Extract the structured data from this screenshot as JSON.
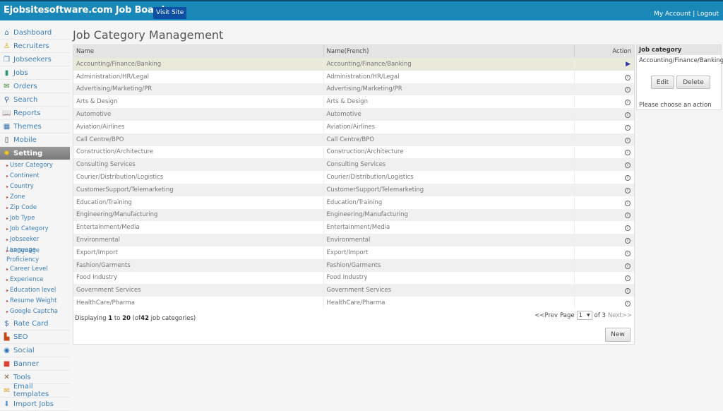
{
  "header": {
    "brand": "Ejobsitesoftware.com Job Board",
    "visit_site": "Visit Site",
    "my_account": "My Account",
    "separator": "|",
    "logout": "Logout"
  },
  "sidebar": {
    "items": [
      {
        "label": "Dashboard",
        "icon": "home-icon"
      },
      {
        "label": "Recruiters",
        "icon": "recruiter-icon"
      },
      {
        "label": "Jobseekers",
        "icon": "jobseekers-icon"
      },
      {
        "label": "Jobs",
        "icon": "jobs-icon"
      },
      {
        "label": "Orders",
        "icon": "orders-icon"
      },
      {
        "label": "Search",
        "icon": "search-icon"
      },
      {
        "label": "Reports",
        "icon": "reports-icon"
      },
      {
        "label": "Themes",
        "icon": "themes-icon"
      },
      {
        "label": "Mobile",
        "icon": "mobile-icon"
      },
      {
        "label": "Setting",
        "icon": "gear-icon",
        "active": true
      }
    ],
    "sub_items": [
      "User Category",
      "Continent",
      "Country",
      "Zone",
      "Zip Code",
      "Job Type",
      "Job Category",
      "Jobseeker Language",
      "Language Proficiency",
      "Career Level",
      "Experience",
      "Education level",
      "Resume Weight",
      "Google Captcha"
    ],
    "items_after": [
      {
        "label": "Rate Card",
        "icon": "dollar-icon"
      },
      {
        "label": "SEO",
        "icon": "chart-icon"
      },
      {
        "label": "Social",
        "icon": "social-icon"
      },
      {
        "label": "Banner",
        "icon": "banner-icon"
      },
      {
        "label": "Tools",
        "icon": "tools-icon"
      },
      {
        "label": "Email templates",
        "icon": "email-icon"
      },
      {
        "label": "Import Jobs",
        "icon": "import-icon"
      }
    ]
  },
  "main": {
    "title": "Job Category Management",
    "columns": [
      "Name",
      "Name(French)",
      "Action"
    ],
    "rows": [
      [
        "Accounting/Finance/Banking",
        "Accounting/Finance/Banking"
      ],
      [
        "Administration/HR/Legal",
        "Administration/HR/Legal"
      ],
      [
        "Advertising/Marketing/PR",
        "Advertising/Marketing/PR"
      ],
      [
        "Arts & Design",
        "Arts & Design"
      ],
      [
        "Automotive",
        "Automotive"
      ],
      [
        "Aviation/Airlines",
        "Aviation/Airlines"
      ],
      [
        "Call Centre/BPO",
        "Call Centre/BPO"
      ],
      [
        "Construction/Architecture",
        "Construction/Architecture"
      ],
      [
        "Consulting Services",
        "Consulting Services"
      ],
      [
        "Courier/Distribution/Logistics",
        "Courier/Distribution/Logistics"
      ],
      [
        "CustomerSupport/Telemarketing",
        "CustomerSupport/Telemarketing"
      ],
      [
        "Education/Training",
        "Education/Training"
      ],
      [
        "Engineering/Manufacturing",
        "Engineering/Manufacturing"
      ],
      [
        "Entertainment/Media",
        "Entertainment/Media"
      ],
      [
        "Environmental",
        "Environmental"
      ],
      [
        "Export/Import",
        "Export/Import"
      ],
      [
        "Fashion/Garments",
        "Fashion/Garments"
      ],
      [
        "Food Industry",
        "Food Industry"
      ],
      [
        "Government Services",
        "Government Services"
      ],
      [
        "HealthCare/Pharma",
        "HealthCare/Pharma"
      ]
    ],
    "selected_row": 0,
    "display": {
      "prefix": "Displaying",
      "from": "1",
      "to_word": "to",
      "to": "20",
      "of_prefix": "(of",
      "total": "42",
      "suffix": "job categories)"
    },
    "pager": {
      "prev": "<<Prev",
      "page_label": "Page",
      "page": "1",
      "of": "of 3",
      "next": "Next>>"
    },
    "new_button": "New"
  },
  "panel": {
    "title": "Job category",
    "selected": "Accounting/Finance/Banking",
    "edit": "Edit",
    "delete": "Delete",
    "message": "Please choose an action"
  }
}
